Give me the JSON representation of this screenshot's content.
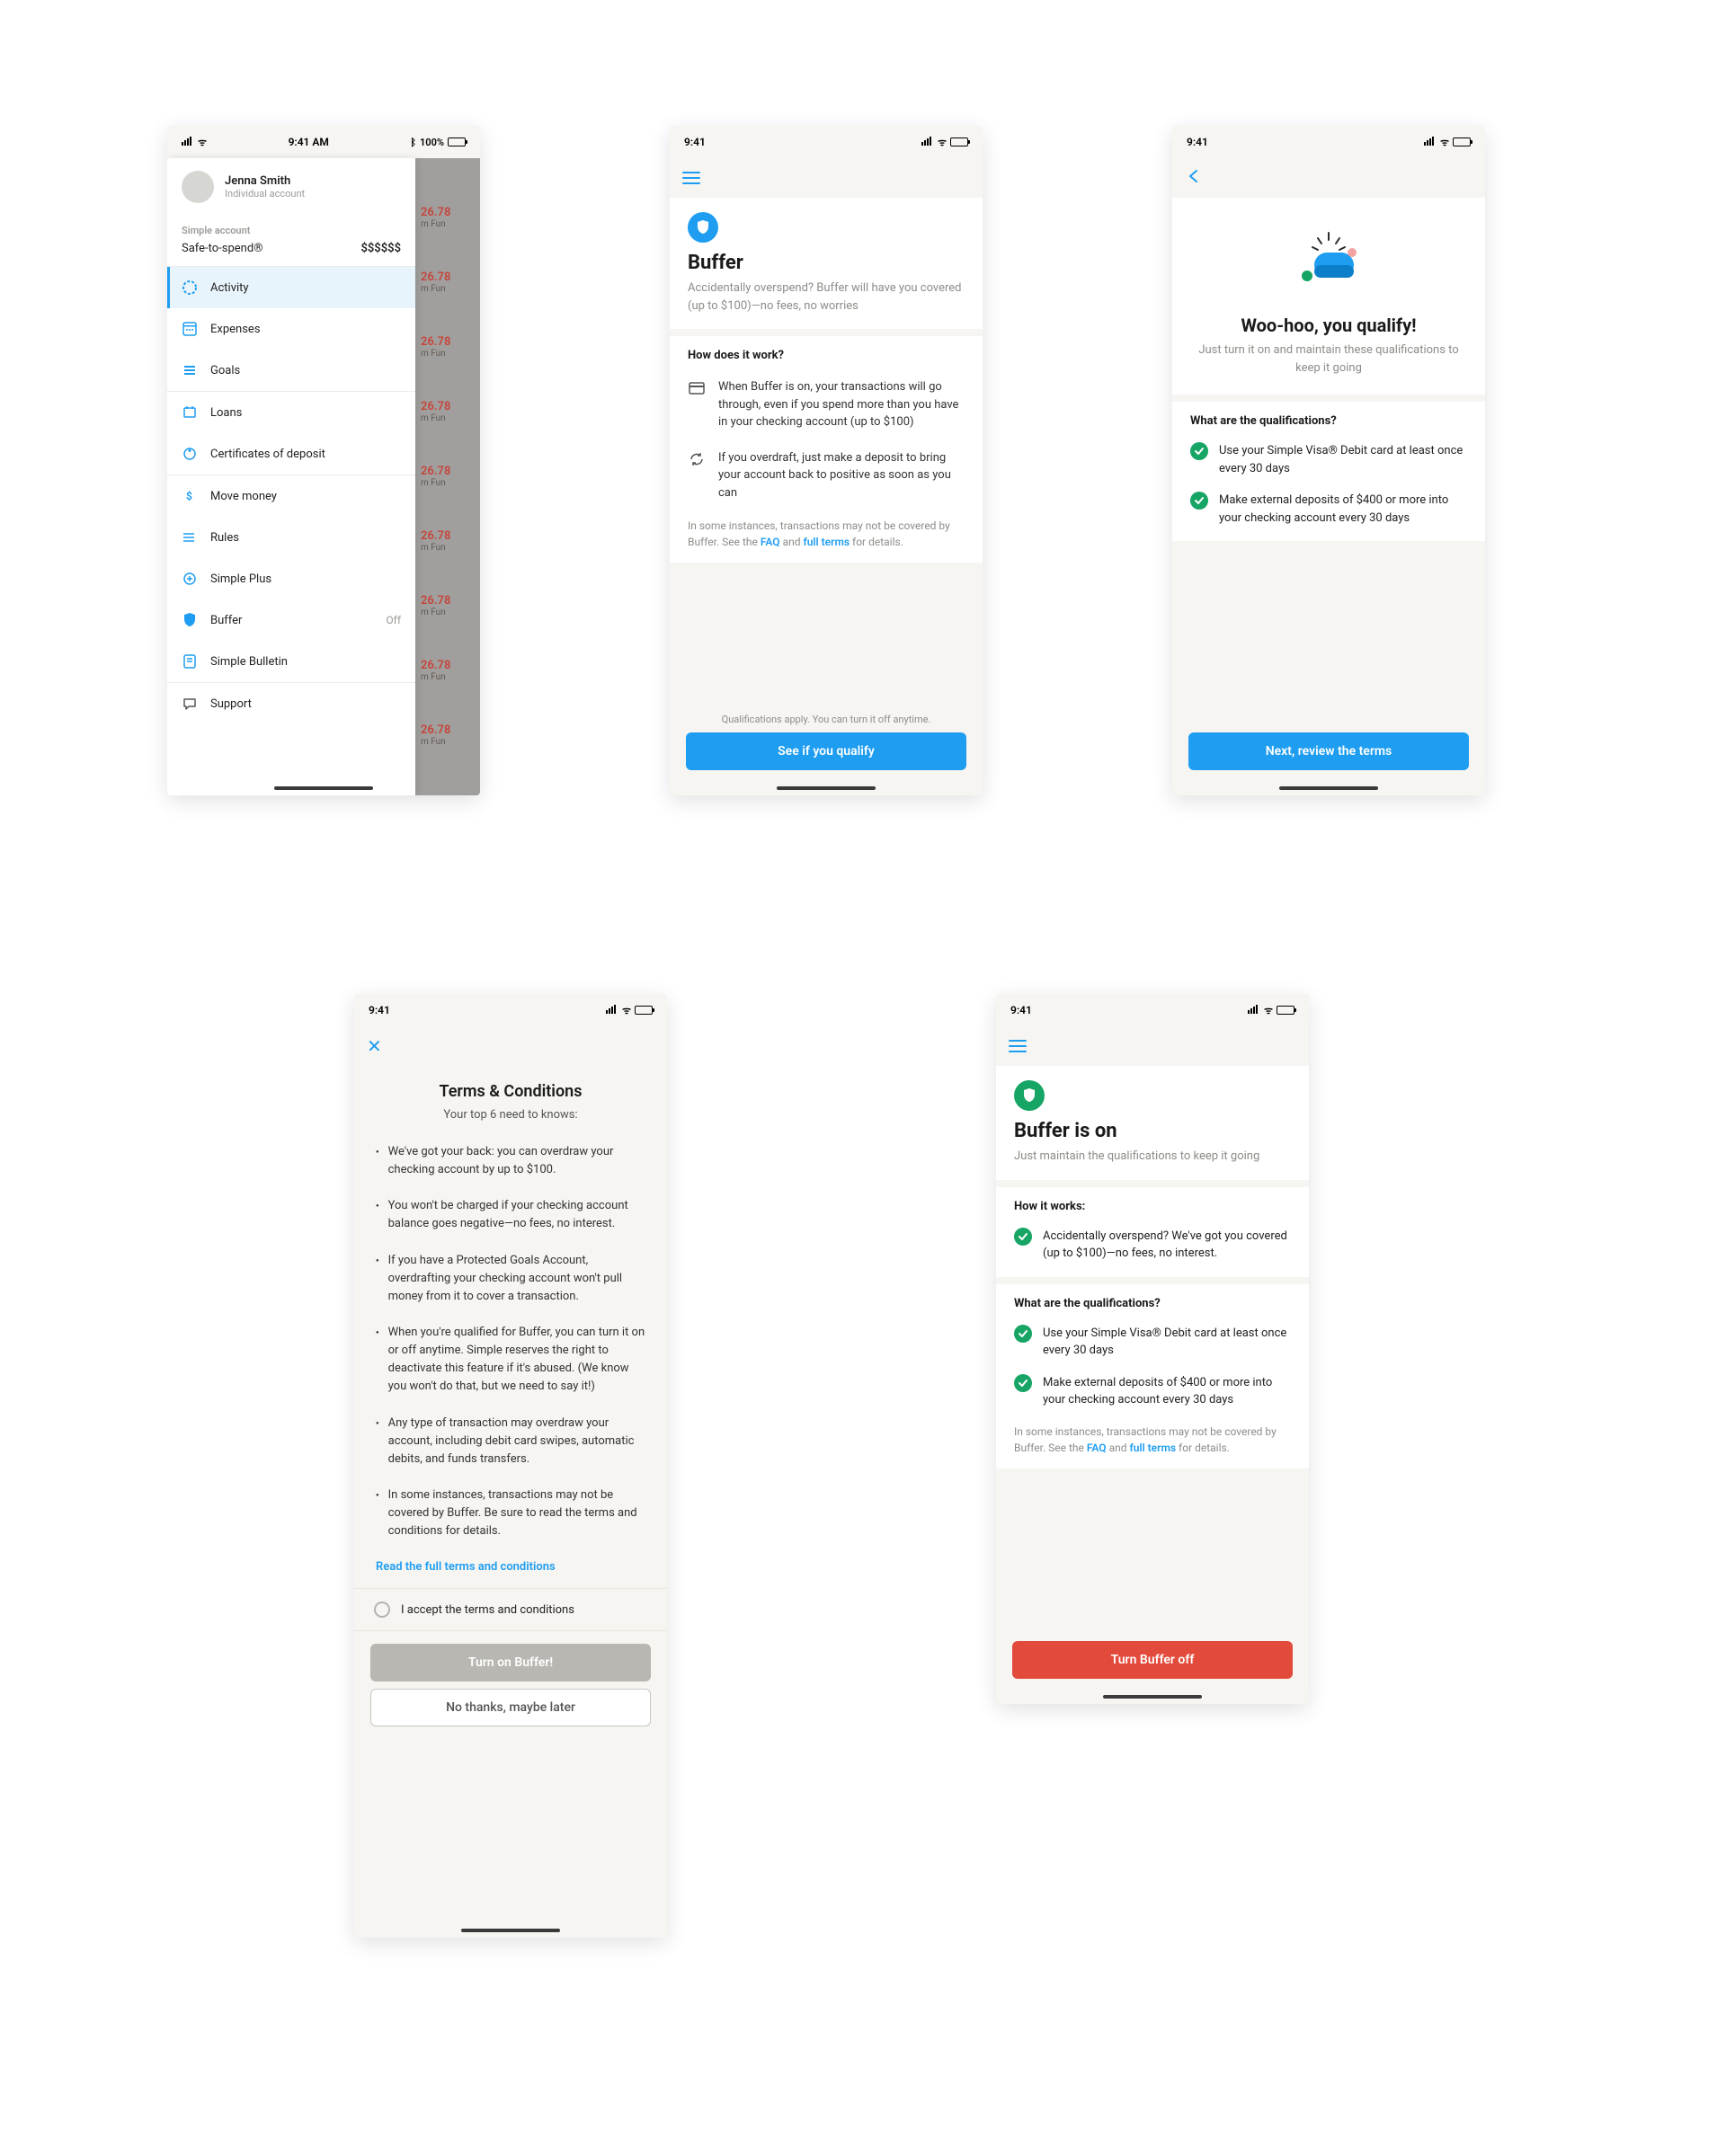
{
  "status": {
    "time": "9:41",
    "time_full": "9:41 AM",
    "battery_right": "100%"
  },
  "phone1": {
    "profile": {
      "name": "Jenna Smith",
      "sub": "Individual account"
    },
    "account": {
      "title": "Simple account",
      "sts_label": "Safe-to-spend®",
      "sts_value": "$$$$$$"
    },
    "nav1": [
      {
        "label": "Activity",
        "active": true,
        "color": "#1e9df1"
      },
      {
        "label": "Expenses",
        "color": "#1e9df1"
      },
      {
        "label": "Goals",
        "color": "#1e9df1"
      }
    ],
    "nav2": [
      {
        "label": "Loans",
        "color": "#1e9df1"
      },
      {
        "label": "Certificates of deposit",
        "color": "#1e9df1"
      }
    ],
    "nav3": [
      {
        "label": "Move money",
        "color": "#1e9df1"
      },
      {
        "label": "Rules",
        "color": "#1e9df1"
      },
      {
        "label": "Simple Plus",
        "color": "#1e9df1"
      },
      {
        "label": "Buffer",
        "tail": "Off",
        "color": "#1e9df1"
      },
      {
        "label": "Simple Bulletin",
        "color": "#1e9df1"
      }
    ],
    "nav4": [
      {
        "label": "Support",
        "color": "#555"
      }
    ],
    "bg_rows": {
      "amount": "26.78",
      "sub": "m Fun"
    }
  },
  "phone2": {
    "title": "Buffer",
    "subtitle": "Accidentally overspend? Buffer will have you covered (up to $100)—no fees, no worries",
    "how_h": "How does it work?",
    "rows": [
      "When Buffer is on, your transactions will go through, even if you spend more than you have in your checking account (up to $100)",
      "If you overdraft, just make a deposit to bring your account back to positive as soon as you can"
    ],
    "fine_a": "In some instances, transactions may not be covered by Buffer. See the ",
    "faq": "FAQ",
    "fine_mid": " and ",
    "full_terms": "full terms",
    "fine_b": " for details.",
    "footer": "Qualifications apply. You can turn it off anytime.",
    "cta": "See if you qualify"
  },
  "phone3": {
    "title": "Woo-hoo, you qualify!",
    "subtitle": "Just turn it on and maintain these qualifications to keep it going",
    "qual_h": "What are the qualifications?",
    "quals": [
      "Use your Simple Visa® Debit card at least once every 30 days",
      "Make external deposits of $400 or more into your checking account every 30 days"
    ],
    "cta": "Next, review the terms"
  },
  "phone4": {
    "title": "Terms & Conditions",
    "subtitle": "Your top 6 need to knows:",
    "bullets": [
      "We've got your back: you can overdraw your checking account by up to $100.",
      "You won't be charged if your checking account balance goes negative—no fees, no interest.",
      "If you have a Protected Goals Account, overdrafting your checking account won't pull money from it to cover a transaction.",
      "When you're qualified for Buffer, you can turn it on or off anytime. Simple reserves the right to deactivate this feature if it's abused. (We know you won't do that, but we need to say it!)",
      "Any type of transaction may overdraw your account, including debit card swipes, automatic debits, and funds transfers.",
      "In some instances, transactions may not be covered by Buffer. Be sure to read the terms and conditions for details."
    ],
    "read_full": "Read the full terms and conditions",
    "accept": "I accept the terms and conditions",
    "cta_on": "Turn on Buffer!",
    "cta_later": "No thanks, maybe later"
  },
  "phone5": {
    "title": "Buffer is on",
    "subtitle": "Just maintain the qualifications to keep it going",
    "how_h": "How it works:",
    "how_row": "Accidentally overspend? We've got you covered (up to $100)—no fees, no interest.",
    "qual_h": "What are the qualifications?",
    "quals": [
      "Use your Simple Visa® Debit card at least once every 30 days",
      "Make external deposits of $400 or more into your checking account every 30 days"
    ],
    "fine_a": "In some instances, transactions may not be covered by Buffer. See the ",
    "faq": "FAQ",
    "fine_mid": " and ",
    "full_terms": "full terms",
    "fine_b": " for details.",
    "cta": "Turn Buffer off"
  }
}
